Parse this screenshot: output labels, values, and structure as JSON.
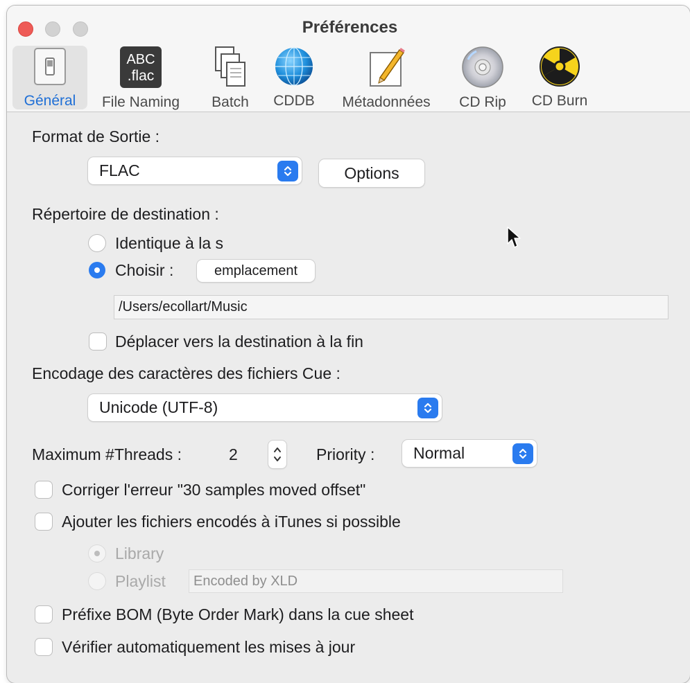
{
  "window": {
    "title": "Préférences"
  },
  "toolbar": {
    "items": [
      {
        "label": "Général",
        "icon": "general-switch-icon",
        "selected": true
      },
      {
        "label": "File Naming",
        "icon": "abc-flac-icon",
        "icon_text_top": "ABC",
        "icon_text_bottom": ".flac"
      },
      {
        "label": "Batch",
        "icon": "documents-stack-icon"
      },
      {
        "label": "CDDB",
        "icon": "globe-icon"
      },
      {
        "label": "Métadonnées",
        "icon": "pencil-paper-icon"
      },
      {
        "label": "CD Rip",
        "icon": "cd-disc-icon"
      },
      {
        "label": "CD Burn",
        "icon": "radiation-icon"
      }
    ]
  },
  "output_format": {
    "label": "Format de Sortie :",
    "value": "FLAC",
    "options_button": "Options"
  },
  "destination": {
    "label": "Répertoire de destination :",
    "same_as_source_label": "Identique à la s",
    "choose_label": "Choisir :",
    "choose_selected": true,
    "location_button": "emplacement",
    "path": "/Users/ecollart/Music",
    "move_at_end_label": "Déplacer vers la destination à la fin"
  },
  "cue_encoding": {
    "label": "Encodage des caractères des fichiers Cue :",
    "value": "Unicode (UTF-8)"
  },
  "threads": {
    "label": "Maximum #Threads :",
    "value": "2"
  },
  "priority": {
    "label": "Priority :",
    "value": "Normal"
  },
  "options": {
    "fix_offset_label": "Corriger l'erreur \"30 samples moved offset\"",
    "add_to_itunes_label": "Ajouter les fichiers encodés à iTunes si possible",
    "library_label": "Library",
    "playlist_label": "Playlist",
    "playlist_value": "Encoded by XLD",
    "bom_label": "Préfixe BOM (Byte Order Mark) dans la cue sheet",
    "auto_update_label": "Vérifier automatiquement les mises à jour"
  },
  "colors": {
    "accent": "#2a7bef",
    "selected_tab_text": "#1f6fd6",
    "close_button": "#ee5b57"
  }
}
